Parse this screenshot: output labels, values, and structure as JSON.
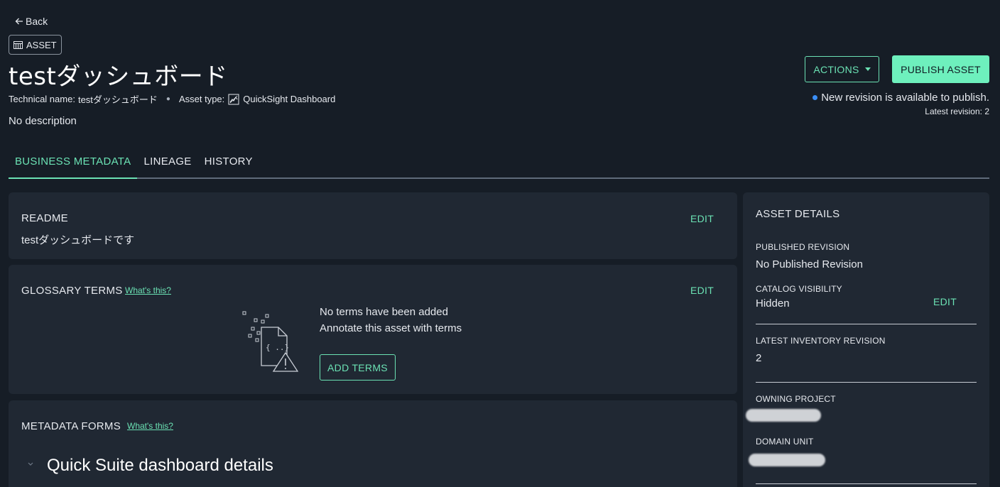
{
  "nav": {
    "back_label": "Back"
  },
  "header": {
    "badge_label": "ASSET",
    "title": "testダッシュボード",
    "technical_name_label": "Technical name:",
    "technical_name": "testダッシュボード",
    "asset_type_label": "Asset type:",
    "asset_type": "QuickSight Dashboard",
    "description": "No description"
  },
  "actions": {
    "actions_label": "ACTIONS",
    "publish_label": "PUBLISH ASSET",
    "revision_notice": "New revision is available to publish.",
    "latest_revision": "Latest revision: 2"
  },
  "tabs": [
    {
      "label": "BUSINESS METADATA",
      "active": true
    },
    {
      "label": "LINEAGE",
      "active": false
    },
    {
      "label": "HISTORY",
      "active": false
    }
  ],
  "readme": {
    "title": "README",
    "edit_label": "EDIT",
    "text": "testダッシュボードです"
  },
  "glossary": {
    "title": "GLOSSARY TERMS",
    "whats_this": "What's this?",
    "edit_label": "EDIT",
    "empty_title": "No terms have been added",
    "empty_sub": "Annotate this asset with terms",
    "add_label": "ADD TERMS"
  },
  "metadata_forms": {
    "title": "METADATA FORMS",
    "whats_this": "What's this?",
    "form_title": "Quick Suite dashboard details"
  },
  "asset_details": {
    "title": "ASSET DETAILS",
    "published_revision_label": "PUBLISHED REVISION",
    "published_revision_value": "No Published Revision",
    "catalog_visibility_label": "CATALOG VISIBILITY",
    "catalog_visibility_value": "Hidden",
    "edit_label": "EDIT",
    "latest_inventory_label": "LATEST INVENTORY REVISION",
    "latest_inventory_value": "2",
    "owning_project_label": "OWNING PROJECT",
    "domain_unit_label": "DOMAIN UNIT"
  },
  "colors": {
    "background": "#161d26",
    "card": "#202833",
    "accent": "#6be2b4",
    "publish_button": "#6ef0bd",
    "status_dot": "#3a8ef6"
  },
  "icons": [
    "arrow-left-icon",
    "table-icon",
    "quicksight-chart-icon",
    "caret-down-icon",
    "status-dot-icon",
    "empty-terms-icon",
    "chevron-down-icon"
  ]
}
